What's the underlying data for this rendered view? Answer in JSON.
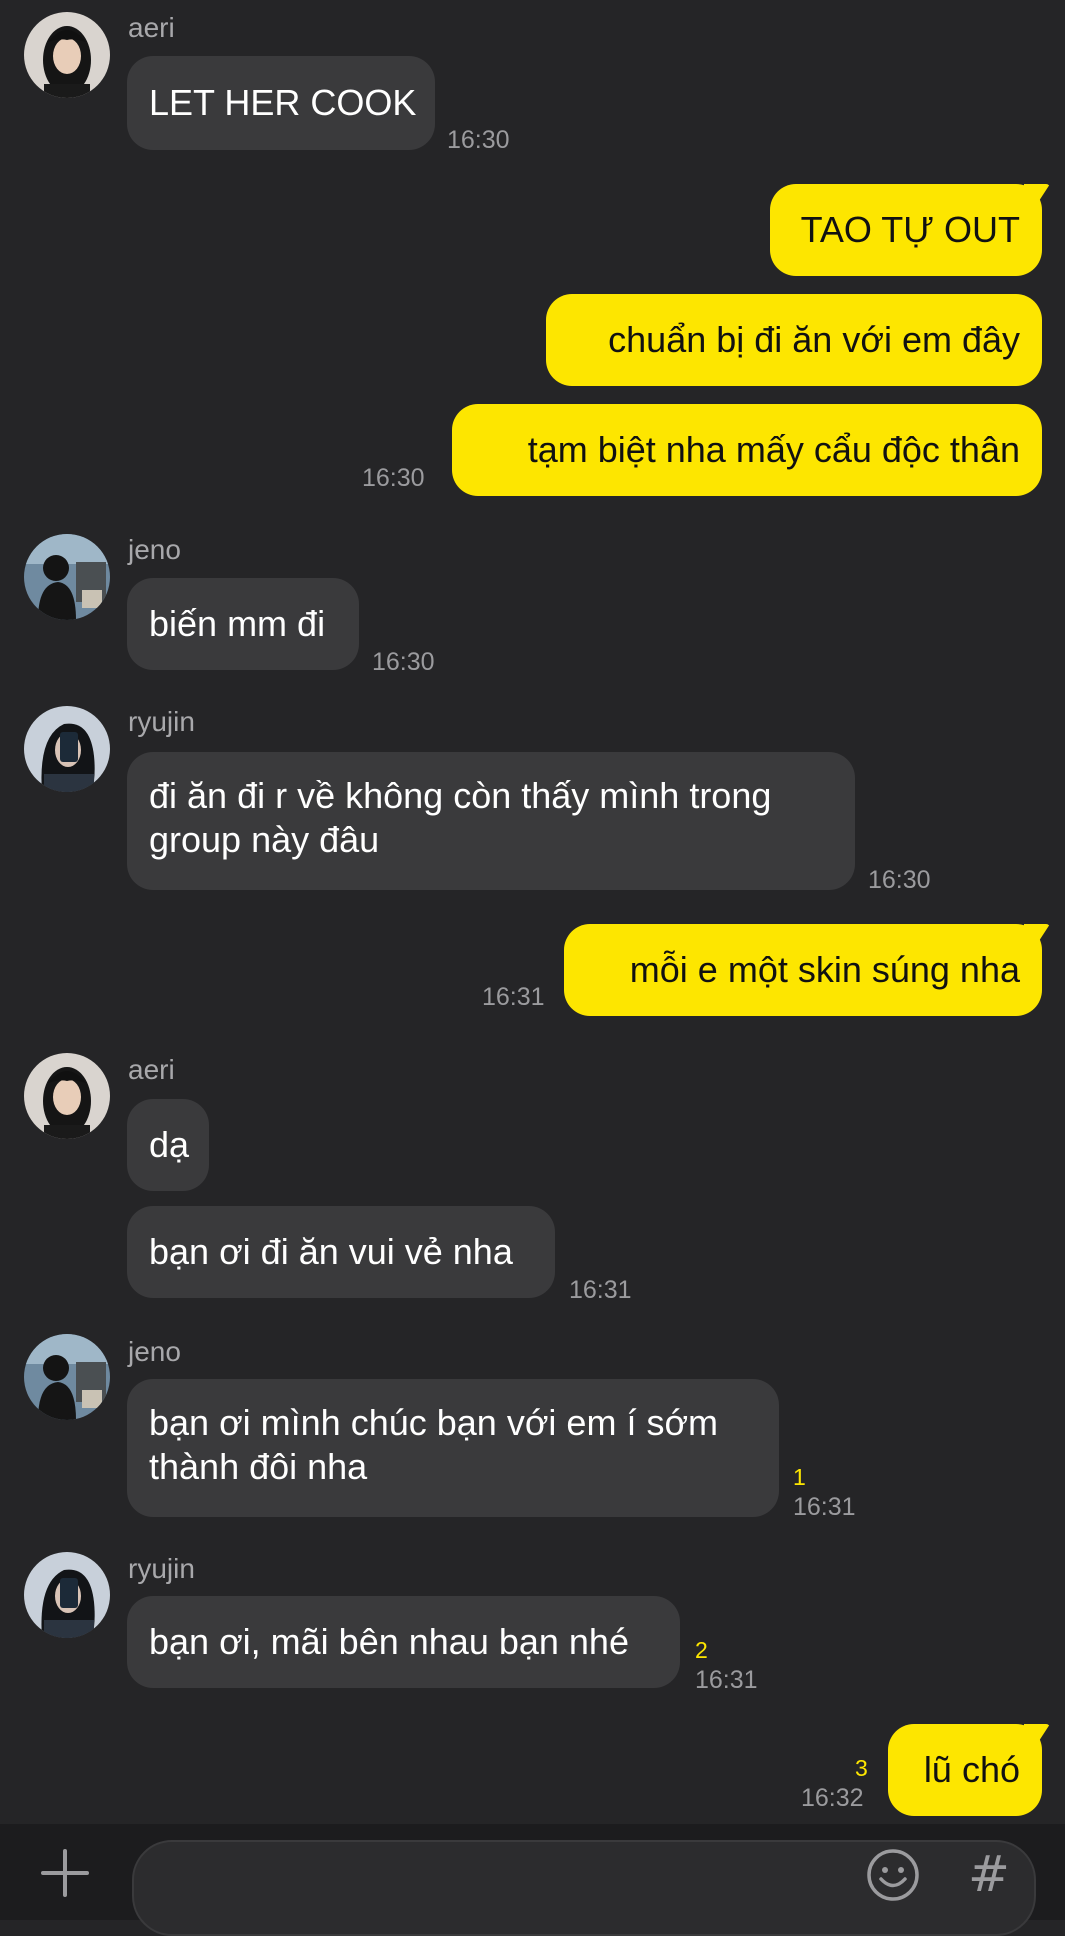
{
  "colors": {
    "background": "#252527",
    "incoming_bubble": "#3a3a3c",
    "outgoing_bubble": "#fde600",
    "unread_count": "#fde600",
    "timestamp": "#9b9b9e",
    "sender_name": "#a8a8ab"
  },
  "messages": [
    {
      "sender": "aeri",
      "text": "LET HER COOK",
      "time": "16:30"
    },
    {
      "text": "TAO TỰ OUT"
    },
    {
      "text": "chuẩn bị đi ăn với em đây"
    },
    {
      "text": "tạm biệt nha mấy cẩu độc thân",
      "time": "16:30"
    },
    {
      "sender": "jeno",
      "text": "biến mm đi",
      "time": "16:30"
    },
    {
      "sender": "ryujin",
      "text": "đi ăn đi r về không còn thấy mình trong group này đâu",
      "time": "16:30"
    },
    {
      "text": "mỗi e một skin súng nha",
      "time": "16:31"
    },
    {
      "sender": "aeri",
      "text": "dạ"
    },
    {
      "text": "bạn ơi đi ăn vui vẻ nha",
      "time": "16:31"
    },
    {
      "sender": "jeno",
      "text": "bạn ơi mình chúc bạn với em í sớm thành đôi nha",
      "time": "16:31",
      "unread": "1"
    },
    {
      "sender": "ryujin",
      "text": "bạn ơi, mãi bên nhau bạn nhé",
      "time": "16:31",
      "unread": "2"
    },
    {
      "text": "lũ chó",
      "time": "16:32",
      "unread": "3"
    }
  ],
  "composer": {
    "plus_icon": "plus-icon",
    "emoji_icon": "emoji-icon",
    "hashtag_label": "#"
  }
}
